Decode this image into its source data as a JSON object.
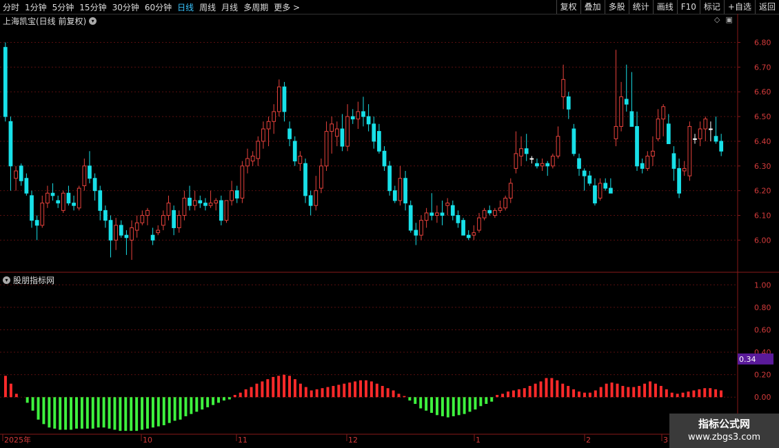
{
  "toolbar": {
    "periods": [
      "分时",
      "1分钟",
      "5分钟",
      "15分钟",
      "30分钟",
      "60分钟",
      "日线",
      "周线",
      "月线",
      "多周期",
      "更多 >"
    ],
    "active_period": "日线",
    "right_buttons": [
      "复权",
      "叠加",
      "多股",
      "统计",
      "画线",
      "F10",
      "标记",
      "+自选",
      "返回"
    ]
  },
  "main_panel": {
    "title": "上海凯宝(日线 前复权)",
    "menu_icon": "chevron-down-circle-icon",
    "right_icons": [
      "diamond-icon",
      "window-icon"
    ]
  },
  "indicator_panel": {
    "title": "股朋指标网",
    "menu_icon": "chevron-down-circle-icon",
    "current_value": "0.34"
  },
  "x_axis": {
    "labels": [
      "2025年",
      "10",
      "11",
      "12",
      "1",
      "2",
      "3"
    ]
  },
  "watermark": {
    "line1": "指标公式网",
    "line2": "www.zbgs3.com"
  },
  "colors": {
    "up": "#e8423c",
    "down": "#18e0e8",
    "doji": "#ffffff",
    "bar_up": "#ff2a2a",
    "bar_down": "#3ef23e",
    "grid": "#5a0f0f",
    "axis_text": "#d43b3b"
  },
  "chart_data": [
    {
      "type": "candlestick",
      "y_axis_ticks": [
        "6.80",
        "6.70",
        "6.60",
        "6.50",
        "6.40",
        "6.30",
        "6.20",
        "6.10",
        "6.00"
      ],
      "ylim": [
        5.87,
        6.86
      ],
      "candles": [
        [
          6.78,
          6.8,
          6.48,
          6.5
        ],
        [
          6.48,
          6.5,
          6.2,
          6.3
        ],
        [
          6.25,
          6.3,
          6.2,
          6.28
        ],
        [
          6.3,
          6.31,
          6.22,
          6.24
        ],
        [
          6.25,
          6.27,
          6.18,
          6.19
        ],
        [
          6.18,
          6.2,
          6.05,
          6.08
        ],
        [
          6.08,
          6.1,
          6.0,
          6.06
        ],
        [
          6.06,
          6.18,
          6.05,
          6.15
        ],
        [
          6.15,
          6.22,
          6.13,
          6.19
        ],
        [
          6.19,
          6.23,
          6.16,
          6.18
        ],
        [
          6.16,
          6.18,
          6.13,
          6.15
        ],
        [
          6.12,
          6.2,
          6.11,
          6.19
        ],
        [
          6.19,
          6.22,
          6.14,
          6.15
        ],
        [
          6.15,
          6.18,
          6.12,
          6.14
        ],
        [
          6.13,
          6.22,
          6.12,
          6.21
        ],
        [
          6.22,
          6.33,
          6.2,
          6.3
        ],
        [
          6.3,
          6.36,
          6.23,
          6.25
        ],
        [
          6.25,
          6.27,
          6.16,
          6.2
        ],
        [
          6.2,
          6.22,
          6.08,
          6.12
        ],
        [
          6.12,
          6.14,
          6.05,
          6.08
        ],
        [
          6.08,
          6.1,
          5.93,
          6.0
        ],
        [
          6.0,
          6.09,
          5.96,
          6.06
        ],
        [
          6.06,
          6.08,
          6.01,
          6.02
        ],
        [
          6.02,
          6.04,
          5.94,
          6.01
        ],
        [
          6.0,
          6.08,
          5.92,
          6.05
        ],
        [
          6.04,
          6.1,
          6.01,
          6.07
        ],
        [
          6.07,
          6.12,
          6.06,
          6.1
        ],
        [
          6.1,
          6.13,
          6.06,
          6.12
        ],
        [
          6.02,
          6.05,
          5.98,
          6.0
        ],
        [
          6.03,
          6.06,
          6.02,
          6.04
        ],
        [
          6.06,
          6.12,
          6.04,
          6.1
        ],
        [
          6.1,
          6.18,
          6.08,
          6.15
        ],
        [
          6.12,
          6.14,
          6.02,
          6.05
        ],
        [
          6.05,
          6.12,
          6.03,
          6.1
        ],
        [
          6.1,
          6.2,
          6.08,
          6.17
        ],
        [
          6.17,
          6.22,
          6.12,
          6.14
        ],
        [
          6.14,
          6.2,
          6.12,
          6.16
        ],
        [
          6.16,
          6.18,
          6.13,
          6.15
        ],
        [
          6.15,
          6.17,
          6.12,
          6.14
        ],
        [
          6.14,
          6.2,
          6.13,
          6.15
        ],
        [
          6.15,
          6.17,
          6.12,
          6.16
        ],
        [
          6.16,
          6.18,
          6.06,
          6.08
        ],
        [
          6.08,
          6.12,
          6.07,
          6.16
        ],
        [
          6.16,
          6.24,
          6.14,
          6.2
        ],
        [
          6.2,
          6.22,
          6.15,
          6.17
        ],
        [
          6.17,
          6.32,
          6.15,
          6.3
        ],
        [
          6.3,
          6.37,
          6.27,
          6.33
        ],
        [
          6.32,
          6.36,
          6.3,
          6.34
        ],
        [
          6.33,
          6.42,
          6.3,
          6.4
        ],
        [
          6.4,
          6.48,
          6.37,
          6.45
        ],
        [
          6.45,
          6.5,
          6.38,
          6.48
        ],
        [
          6.48,
          6.55,
          6.43,
          6.52
        ],
        [
          6.52,
          6.65,
          6.5,
          6.62
        ],
        [
          6.62,
          6.64,
          6.48,
          6.52
        ],
        [
          6.45,
          6.48,
          6.38,
          6.41
        ],
        [
          6.4,
          6.42,
          6.3,
          6.32
        ],
        [
          6.31,
          6.36,
          6.28,
          6.34
        ],
        [
          6.31,
          6.33,
          6.15,
          6.18
        ],
        [
          6.18,
          6.2,
          6.1,
          6.14
        ],
        [
          6.14,
          6.26,
          6.12,
          6.2
        ],
        [
          6.21,
          6.33,
          6.19,
          6.3
        ],
        [
          6.3,
          6.48,
          6.28,
          6.44
        ],
        [
          6.44,
          6.5,
          6.35,
          6.47
        ],
        [
          6.42,
          6.48,
          6.38,
          6.45
        ],
        [
          6.45,
          6.51,
          6.36,
          6.38
        ],
        [
          6.38,
          6.55,
          6.36,
          6.5
        ],
        [
          6.5,
          6.53,
          6.47,
          6.49
        ],
        [
          6.49,
          6.56,
          6.45,
          6.52
        ],
        [
          6.52,
          6.58,
          6.46,
          6.5
        ],
        [
          6.5,
          6.55,
          6.44,
          6.47
        ],
        [
          6.47,
          6.5,
          6.37,
          6.4
        ],
        [
          6.44,
          6.47,
          6.35,
          6.36
        ],
        [
          6.36,
          6.38,
          6.28,
          6.3
        ],
        [
          6.3,
          6.32,
          6.18,
          6.2
        ],
        [
          6.2,
          6.22,
          6.15,
          6.16
        ],
        [
          6.16,
          6.3,
          6.14,
          6.25
        ],
        [
          6.25,
          6.28,
          6.12,
          6.15
        ],
        [
          6.14,
          6.16,
          6.03,
          6.04
        ],
        [
          6.04,
          6.07,
          5.98,
          6.02
        ],
        [
          6.02,
          6.1,
          6.0,
          6.08
        ],
        [
          6.08,
          6.13,
          6.05,
          6.11
        ],
        [
          6.11,
          6.19,
          6.08,
          6.1
        ],
        [
          6.1,
          6.14,
          6.07,
          6.11
        ],
        [
          6.11,
          6.16,
          6.06,
          6.1
        ],
        [
          6.14,
          6.17,
          6.1,
          6.15
        ],
        [
          6.14,
          6.16,
          6.08,
          6.1
        ],
        [
          6.1,
          6.12,
          6.05,
          6.07
        ],
        [
          6.08,
          6.09,
          6.02,
          6.02
        ],
        [
          6.02,
          6.04,
          6.0,
          6.01
        ],
        [
          6.02,
          6.06,
          6.0,
          6.03
        ],
        [
          6.04,
          6.11,
          6.03,
          6.09
        ],
        [
          6.09,
          6.13,
          6.08,
          6.12
        ],
        [
          6.12,
          6.14,
          6.1,
          6.11
        ],
        [
          6.1,
          6.13,
          6.09,
          6.12
        ],
        [
          6.12,
          6.16,
          6.11,
          6.13
        ],
        [
          6.13,
          6.18,
          6.12,
          6.17
        ],
        [
          6.17,
          6.25,
          6.15,
          6.23
        ],
        [
          6.29,
          6.44,
          6.27,
          6.35
        ],
        [
          6.34,
          6.42,
          6.3,
          6.37
        ],
        [
          6.37,
          6.43,
          6.32,
          6.35
        ],
        [
          6.33,
          6.34,
          6.31,
          6.33
        ],
        [
          6.31,
          6.33,
          6.29,
          6.3
        ],
        [
          6.3,
          6.33,
          6.28,
          6.31
        ],
        [
          6.31,
          6.32,
          6.26,
          6.3
        ],
        [
          6.3,
          6.35,
          6.29,
          6.34
        ],
        [
          6.34,
          6.46,
          6.33,
          6.42
        ],
        [
          6.58,
          6.71,
          6.53,
          6.65
        ],
        [
          6.58,
          6.6,
          6.49,
          6.53
        ],
        [
          6.45,
          6.47,
          6.34,
          6.35
        ],
        [
          6.33,
          6.35,
          6.26,
          6.29
        ],
        [
          6.28,
          6.29,
          6.2,
          6.26
        ],
        [
          6.26,
          6.28,
          6.22,
          6.23
        ],
        [
          6.22,
          6.25,
          6.14,
          6.15
        ],
        [
          6.17,
          6.25,
          6.16,
          6.23
        ],
        [
          6.23,
          6.25,
          6.2,
          6.21
        ],
        [
          6.21,
          6.25,
          6.19,
          6.19
        ],
        [
          6.41,
          6.77,
          6.38,
          6.46
        ],
        [
          6.46,
          6.64,
          6.44,
          6.58
        ],
        [
          6.57,
          6.71,
          6.52,
          6.55
        ],
        [
          6.52,
          6.68,
          6.47,
          6.46
        ],
        [
          6.46,
          6.52,
          6.28,
          6.3
        ],
        [
          6.31,
          6.33,
          6.27,
          6.29
        ],
        [
          6.29,
          6.36,
          6.28,
          6.34
        ],
        [
          6.34,
          6.42,
          6.3,
          6.36
        ],
        [
          6.41,
          6.53,
          6.4,
          6.49
        ],
        [
          6.49,
          6.55,
          6.42,
          6.54
        ],
        [
          6.47,
          6.51,
          6.39,
          6.39
        ],
        [
          6.35,
          6.38,
          6.24,
          6.29
        ],
        [
          6.29,
          6.33,
          6.17,
          6.19
        ],
        [
          6.28,
          6.32,
          6.26,
          6.29
        ],
        [
          6.26,
          6.48,
          6.24,
          6.46
        ],
        [
          6.41,
          6.43,
          6.39,
          6.41
        ],
        [
          6.41,
          6.48,
          6.38,
          6.45
        ],
        [
          6.45,
          6.5,
          6.4,
          6.49
        ],
        [
          6.45,
          6.48,
          6.4,
          6.45
        ],
        [
          6.42,
          6.5,
          6.39,
          6.4
        ],
        [
          6.4,
          6.43,
          6.34,
          6.36
        ]
      ]
    },
    {
      "type": "bar",
      "y_axis_ticks": [
        "1.00",
        "0.80",
        "0.60",
        "0.40",
        "0.20",
        "0.00"
      ],
      "ylim": [
        -0.33,
        1.1
      ],
      "values": [
        0.19,
        0.12,
        0.03,
        0.0,
        -0.05,
        -0.12,
        -0.2,
        -0.24,
        -0.27,
        -0.28,
        -0.29,
        -0.29,
        -0.29,
        -0.28,
        -0.28,
        -0.28,
        -0.28,
        -0.27,
        -0.27,
        -0.28,
        -0.29,
        -0.3,
        -0.3,
        -0.3,
        -0.3,
        -0.29,
        -0.28,
        -0.27,
        -0.26,
        -0.25,
        -0.23,
        -0.21,
        -0.2,
        -0.17,
        -0.15,
        -0.13,
        -0.11,
        -0.09,
        -0.07,
        -0.05,
        -0.03,
        -0.02,
        0.02,
        0.04,
        0.07,
        0.09,
        0.12,
        0.14,
        0.16,
        0.18,
        0.19,
        0.2,
        0.19,
        0.16,
        0.12,
        0.09,
        0.06,
        0.07,
        0.08,
        0.09,
        0.1,
        0.11,
        0.12,
        0.13,
        0.14,
        0.15,
        0.15,
        0.14,
        0.12,
        0.1,
        0.08,
        0.06,
        0.03,
        0.01,
        -0.03,
        -0.06,
        -0.1,
        -0.12,
        -0.14,
        -0.16,
        -0.17,
        -0.18,
        -0.17,
        -0.16,
        -0.15,
        -0.13,
        -0.11,
        -0.08,
        -0.06,
        -0.04,
        0.02,
        0.03,
        0.05,
        0.06,
        0.07,
        0.08,
        0.1,
        0.12,
        0.14,
        0.17,
        0.17,
        0.15,
        0.12,
        0.1,
        0.07,
        0.05,
        0.04,
        0.04,
        0.06,
        0.09,
        0.12,
        0.13,
        0.12,
        0.1,
        0.09,
        0.09,
        0.1,
        0.12,
        0.14,
        0.12,
        0.1,
        0.07,
        0.04,
        0.03,
        0.04,
        0.05,
        0.06,
        0.07,
        0.08,
        0.08,
        0.07,
        0.06
      ]
    }
  ]
}
